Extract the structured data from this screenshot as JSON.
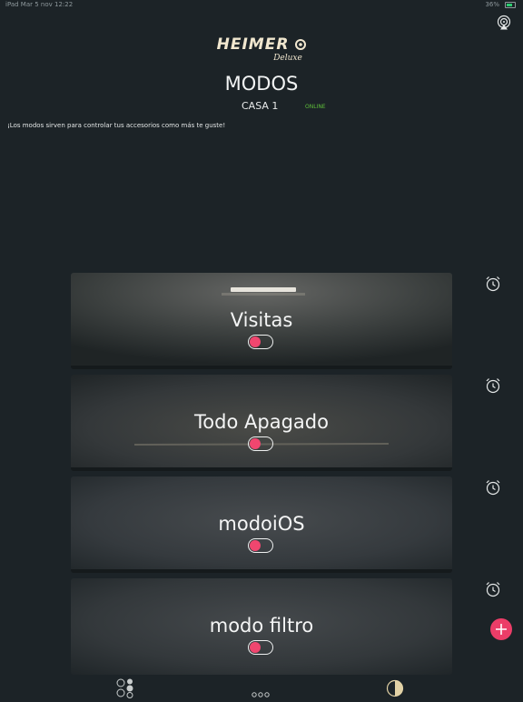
{
  "status_bar": {
    "left": "iPad  Mar 5 nov 12:22",
    "right": "36%"
  },
  "logo": {
    "main": "HEIMER",
    "sub": "Deluxe"
  },
  "header": {
    "title": "MODOS",
    "house": "CASA 1",
    "status": "ONLINE",
    "description": "¡Los modos sirven para controlar tus accesorios como más te guste!"
  },
  "modes": [
    {
      "name": "Visitas",
      "enabled": false
    },
    {
      "name": "Todo Apagado",
      "enabled": false
    },
    {
      "name": "modoiOS",
      "enabled": false
    },
    {
      "name": "modo filtro",
      "enabled": false
    }
  ],
  "icons": {
    "cast": "cast-icon",
    "alarm": "alarm-clock-icon",
    "add": "plus-icon",
    "nav_devices": "devices-icon",
    "nav_more": "more-dots-icon",
    "nav_modes": "half-circle-icon"
  },
  "colors": {
    "background": "#1c2327",
    "accent": "#ec3d68",
    "online": "#5fbf3b",
    "logo": "#f1e7cf"
  }
}
